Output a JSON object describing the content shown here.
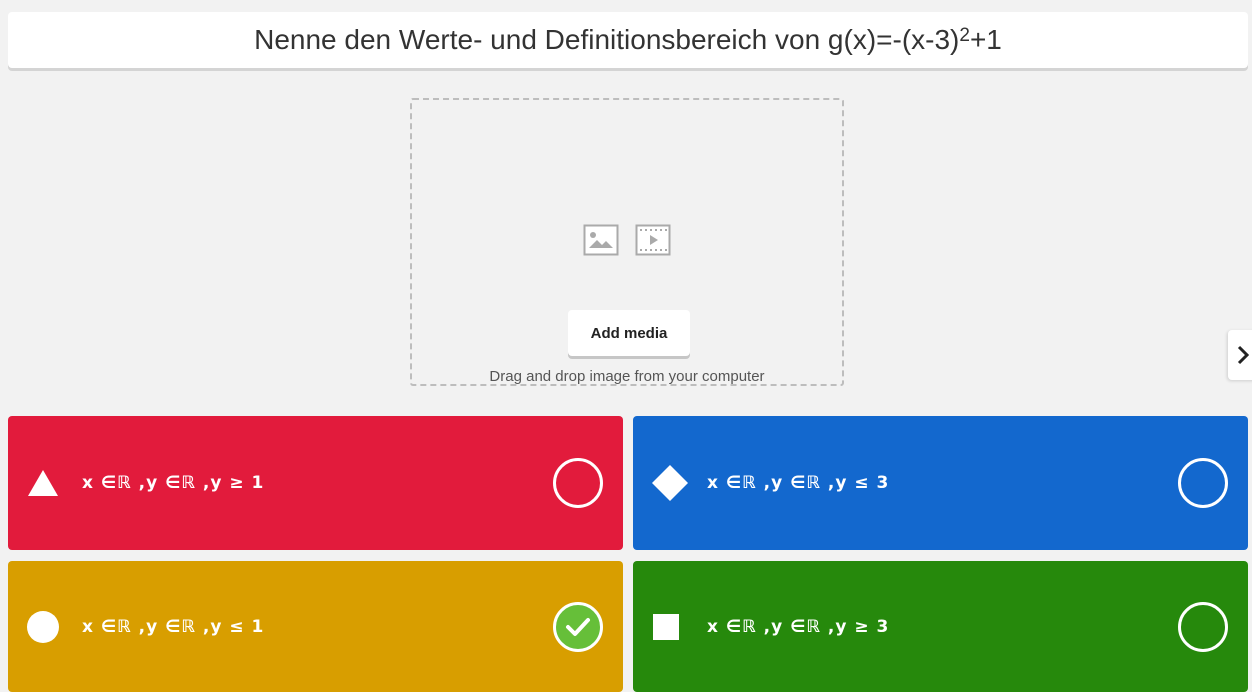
{
  "question": {
    "text_prefix": "Nenne den Werte- und Definitionsbereich von g(x)=-(x-3)",
    "exponent": "2",
    "text_suffix": "+1"
  },
  "media": {
    "icons": [
      "image-icon",
      "video-icon"
    ],
    "add_button": "Add media",
    "hint": "Drag and drop image from your computer"
  },
  "navigation": {
    "next_icon": "chevron-right-icon"
  },
  "answers": [
    {
      "shape": "triangle",
      "text": "x ∈ℝ ,y ∈ℝ ,y ≥ 1",
      "color": "#e21b3c",
      "correct": false
    },
    {
      "shape": "diamond",
      "text": "x ∈ℝ ,y ∈ℝ ,y ≤ 3",
      "color": "#1368ce",
      "correct": false
    },
    {
      "shape": "circle",
      "text": "x ∈ℝ ,y ∈ℝ ,y ≤ 1",
      "color": "#d89e00",
      "correct": true
    },
    {
      "shape": "square",
      "text": "x ∈ℝ ,y ∈ℝ ,y ≥ 3",
      "color": "#26890c",
      "correct": false
    }
  ]
}
